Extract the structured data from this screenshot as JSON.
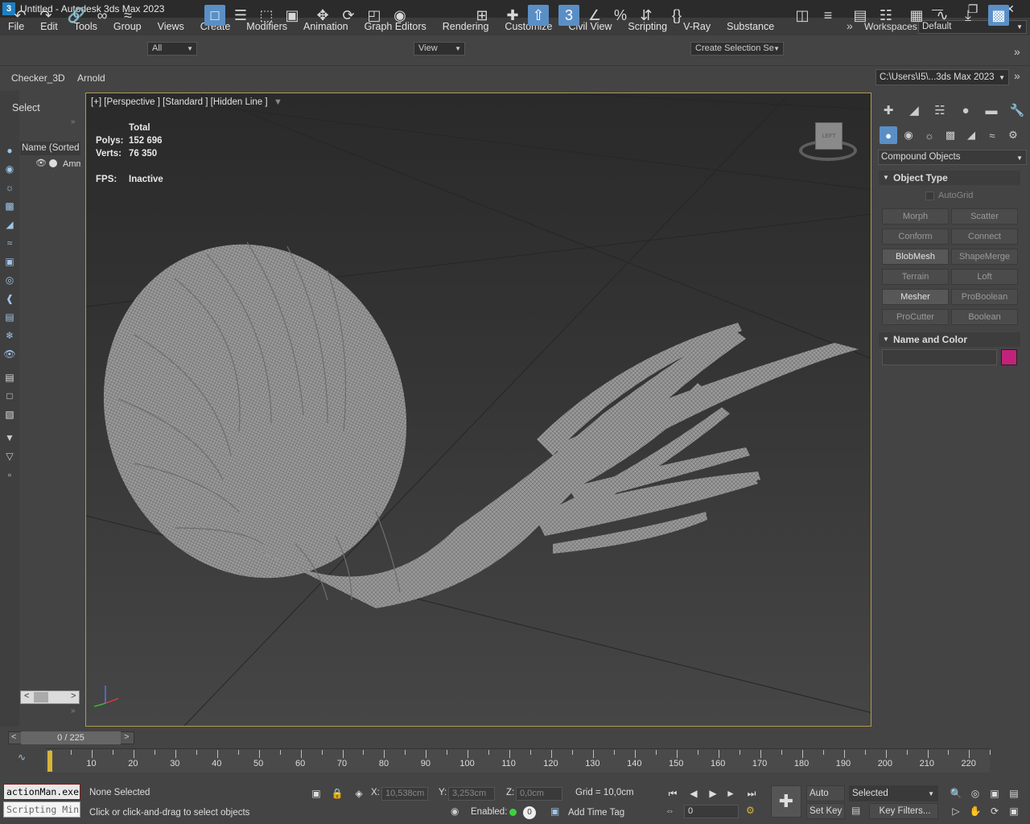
{
  "window": {
    "title": "Untitled - Autodesk 3ds Max 2023",
    "app_icon": "3"
  },
  "menu": [
    "File",
    "Edit",
    "Tools",
    "Group",
    "Views",
    "Create",
    "Modifiers",
    "Animation",
    "Graph Editors",
    "Rendering",
    "Customize",
    "Civil View",
    "Scripting",
    "V-Ray",
    "Substance"
  ],
  "workspaces": {
    "label": "Workspaces:",
    "value": "Default"
  },
  "toolbar": {
    "selection_filter": "All",
    "ref_coord": "View",
    "named_selection": "Create Selection Se"
  },
  "ribbon": {
    "tabs": [
      "Checker_3D",
      "Arnold"
    ],
    "project_path": "C:\\Users\\I5\\...3ds Max 2023"
  },
  "scene_explorer": {
    "title": "Select",
    "column_header": "Name (Sorted A",
    "row": "Amm"
  },
  "viewport": {
    "label": "[+] [Perspective ] [Standard ] [Hidden Line ]",
    "stats": {
      "total": "Total",
      "polys_label": "Polys:",
      "polys": "152 696",
      "verts_label": "Verts:",
      "verts": "76 350",
      "fps_label": "FPS:",
      "fps": "Inactive"
    },
    "viewcube_face": "LEFT"
  },
  "command_panel": {
    "category": "Compound Objects",
    "object_type_title": "Object Type",
    "autogrid": "AutoGrid",
    "buttons": [
      [
        "Morph",
        "Scatter"
      ],
      [
        "Conform",
        "Connect"
      ],
      [
        "BlobMesh",
        "ShapeMerge"
      ],
      [
        "Terrain",
        "Loft"
      ],
      [
        "Mesher",
        "ProBoolean"
      ],
      [
        "ProCutter",
        "Boolean"
      ]
    ],
    "enabled_buttons": [
      "BlobMesh",
      "Mesher"
    ],
    "name_color_title": "Name and Color",
    "object_color": "#c2237a"
  },
  "timeline": {
    "frame": "0 / 225",
    "ticks": [
      "10",
      "20",
      "30",
      "40",
      "50",
      "60",
      "70",
      "80",
      "90",
      "100",
      "110",
      "120",
      "130",
      "140",
      "150",
      "160",
      "170",
      "180",
      "190",
      "200",
      "210",
      "220"
    ]
  },
  "status": {
    "maxscript_line1": "actionMan.exe",
    "maxscript_line2": "Scripting Mini",
    "selection": "None Selected",
    "prompt": "Click or click-and-drag to select objects",
    "x_label": "X:",
    "x": "10,538cm",
    "y_label": "Y:",
    "y": "3,253cm",
    "z_label": "Z:",
    "z": "0,0cm",
    "grid": "Grid = 10,0cm",
    "enabled": "Enabled:",
    "add_time_tag": "Add Time Tag",
    "auto_key": "Auto Key",
    "key_mode": "Selected",
    "set_key": "Set Key",
    "key_filters": "Key Filters...",
    "current_frame": "0"
  }
}
